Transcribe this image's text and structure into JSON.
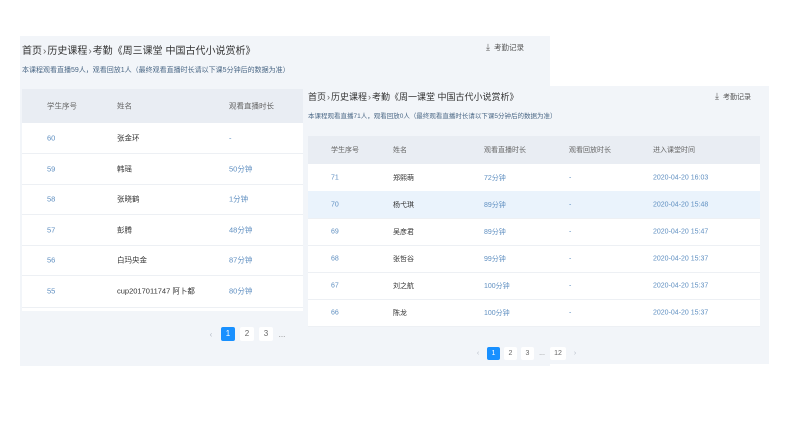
{
  "panel_back": {
    "breadcrumb": [
      "首页",
      "历史课程",
      "考勤《周三课堂 中国古代小说赏析》"
    ],
    "record_link": "考勤记录",
    "summary": "本课程观看直播59人，观看回放1人（最终观看直播时长请以下课5分钟后的数据为准）",
    "columns": [
      "学生序号",
      "姓名",
      "观看直播时长"
    ],
    "rows": [
      {
        "id": "60",
        "name": "张金环",
        "duration": "-"
      },
      {
        "id": "59",
        "name": "韩瑶",
        "duration": "50分钟"
      },
      {
        "id": "58",
        "name": "张晓鹤",
        "duration": "1分钟"
      },
      {
        "id": "57",
        "name": "彭腾",
        "duration": "48分钟"
      },
      {
        "id": "56",
        "name": "白玛央金",
        "duration": "87分钟"
      },
      {
        "id": "55",
        "name": "cup2017011747 阿卜都",
        "duration": "80分钟"
      }
    ],
    "pagination": {
      "prev": "‹",
      "pages": [
        "1",
        "2",
        "3"
      ],
      "ellipsis": "..."
    }
  },
  "panel_front": {
    "breadcrumb": [
      "首页",
      "历史课程",
      "考勤《周一课堂 中国古代小说赏析》"
    ],
    "record_link": "考勤记录",
    "summary": "本课程观看直播71人，观看回放0人（最终观看直播时长请以下课5分钟后的数据为准）",
    "columns": [
      "学生序号",
      "姓名",
      "观看直播时长",
      "观看回放时长",
      "进入课堂时间"
    ],
    "rows": [
      {
        "id": "71",
        "name": "郑熙萌",
        "live": "72分钟",
        "replay": "-",
        "enter": "2020-04-20 16:03"
      },
      {
        "id": "70",
        "name": "杨弋琪",
        "live": "89分钟",
        "replay": "-",
        "enter": "2020-04-20 15:48"
      },
      {
        "id": "69",
        "name": "吴彦君",
        "live": "89分钟",
        "replay": "-",
        "enter": "2020-04-20 15:47"
      },
      {
        "id": "68",
        "name": "张哲谷",
        "live": "99分钟",
        "replay": "-",
        "enter": "2020-04-20 15:37"
      },
      {
        "id": "67",
        "name": "刘之航",
        "live": "100分钟",
        "replay": "-",
        "enter": "2020-04-20 15:37"
      },
      {
        "id": "66",
        "name": "陈龙",
        "live": "100分钟",
        "replay": "-",
        "enter": "2020-04-20 15:37"
      }
    ],
    "pagination": {
      "prev": "‹",
      "pages": [
        "1",
        "2",
        "3"
      ],
      "ellipsis": "...",
      "last": "12",
      "next": "›"
    }
  },
  "colors": {
    "accent": "#1890ff",
    "panel_bg": "#f2f5f9",
    "header_bg": "#e9edf3",
    "highlight_row": "#eaf3fc",
    "text_blue": "#5f8fc1"
  },
  "icons": {
    "record": "download-icon"
  }
}
